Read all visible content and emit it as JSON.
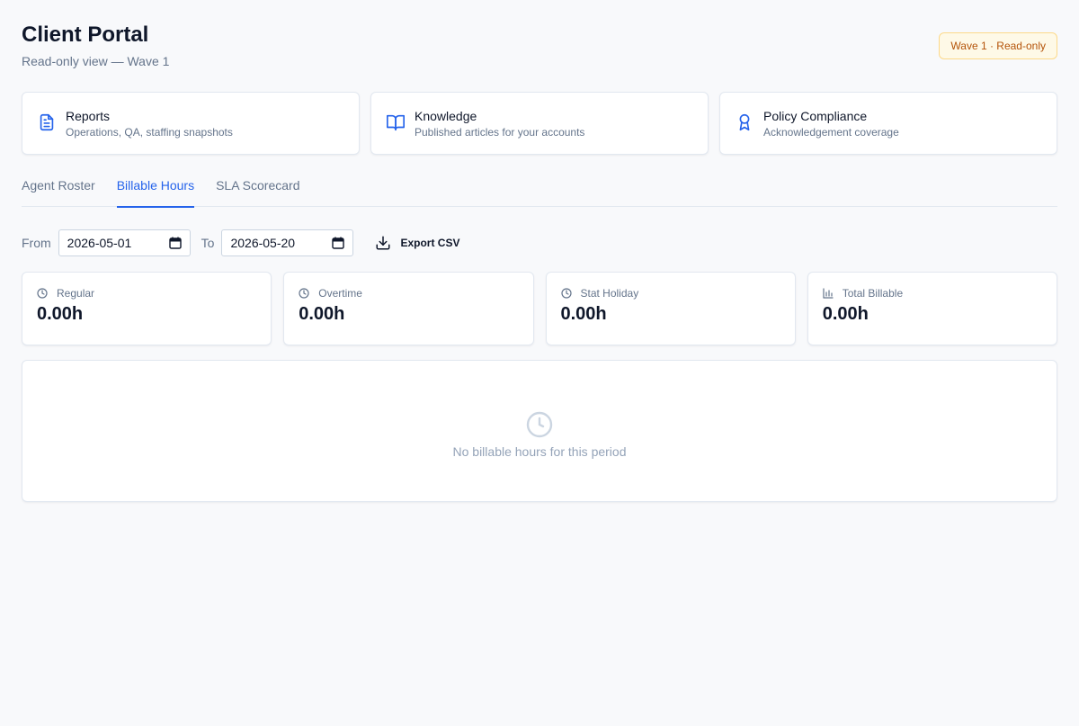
{
  "header": {
    "title": "Client Portal",
    "subtitle": "Read-only view — Wave 1",
    "badge": "Wave 1 · Read-only"
  },
  "quicklinks": [
    {
      "title": "Reports",
      "desc": "Operations, QA, staffing snapshots",
      "icon": "document-icon"
    },
    {
      "title": "Knowledge",
      "desc": "Published articles for your accounts",
      "icon": "book-icon"
    },
    {
      "title": "Policy Compliance",
      "desc": "Acknowledgement coverage",
      "icon": "award-icon"
    }
  ],
  "tabs": [
    {
      "label": "Agent Roster",
      "active": false
    },
    {
      "label": "Billable Hours",
      "active": true
    },
    {
      "label": "SLA Scorecard",
      "active": false
    }
  ],
  "filters": {
    "from_label": "From",
    "from_value": "2026-05-01",
    "to_label": "To",
    "to_value": "2026-05-20",
    "export_label": "Export CSV"
  },
  "stats": [
    {
      "label": "Regular",
      "value": "0.00h",
      "icon": "clock-icon"
    },
    {
      "label": "Overtime",
      "value": "0.00h",
      "icon": "clock-icon"
    },
    {
      "label": "Stat Holiday",
      "value": "0.00h",
      "icon": "clock-icon"
    },
    {
      "label": "Total Billable",
      "value": "0.00h",
      "icon": "bar-chart-icon"
    }
  ],
  "empty": {
    "message": "No billable hours for this period",
    "icon": "clock-icon"
  },
  "colors": {
    "accent": "#2563eb",
    "badge_bg": "#fef9e7",
    "badge_text": "#b45309",
    "muted": "#64748b",
    "background": "#f8f9fb"
  }
}
